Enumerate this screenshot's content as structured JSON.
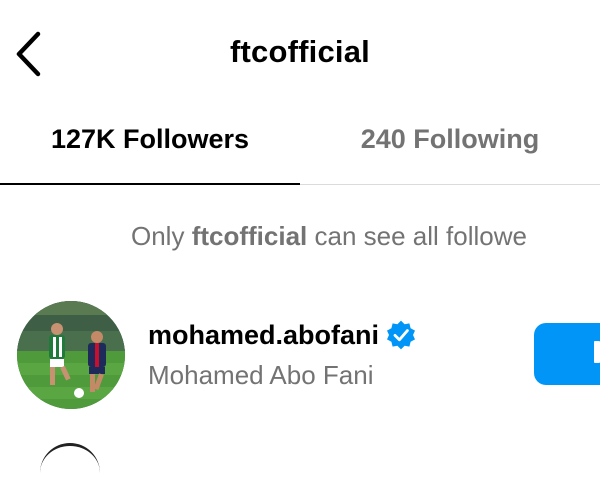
{
  "header": {
    "title": "ftcofficial",
    "back_icon": "chevron-left-icon"
  },
  "tabs": [
    {
      "label": "127K Followers",
      "active": true
    },
    {
      "label": "240 Following",
      "active": false
    }
  ],
  "notice": {
    "prefix": "Only ",
    "account": "ftcofficial",
    "suffix": " can see all followe"
  },
  "followers": [
    {
      "username": "mohamed.abofani",
      "full_name": "Mohamed Abo Fani",
      "verified": true,
      "verified_icon": "verified-badge-icon",
      "button_label": ""
    }
  ],
  "colors": {
    "text_primary": "#000000",
    "text_secondary": "#737373",
    "accent": "#0095f6",
    "divider": "#dbdbdb"
  }
}
